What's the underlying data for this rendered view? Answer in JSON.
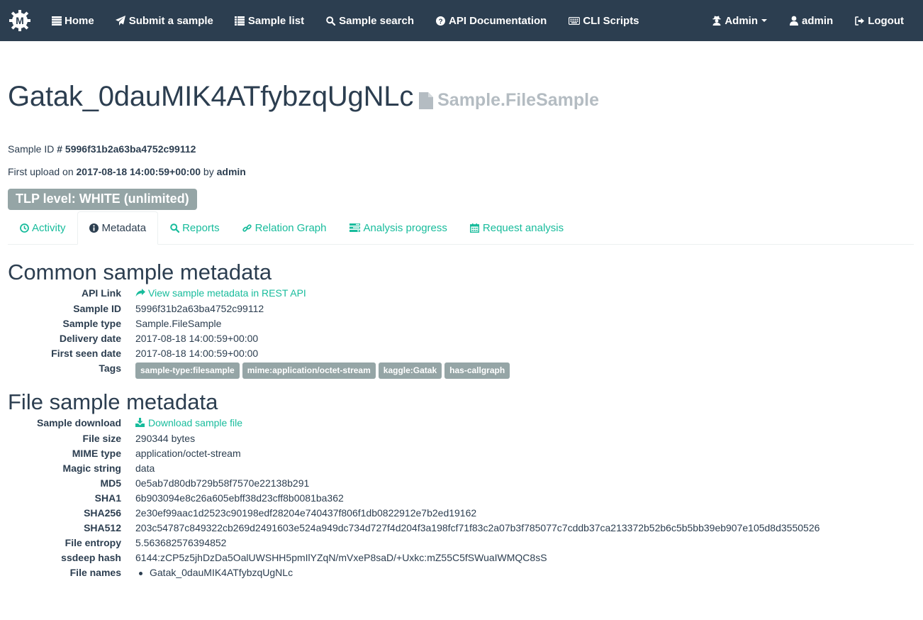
{
  "navbar": {
    "brand_icon": "malice-logo-icon",
    "left": [
      {
        "label": "Home",
        "icon": "list-icon"
      },
      {
        "label": "Submit a sample",
        "icon": "paper-plane-icon"
      },
      {
        "label": "Sample list",
        "icon": "list-icon"
      },
      {
        "label": "Sample search",
        "icon": "search-icon"
      },
      {
        "label": "API Documentation",
        "icon": "question-circle-icon"
      },
      {
        "label": "CLI Scripts",
        "icon": "keyboard-icon"
      }
    ],
    "right": [
      {
        "label": "Admin",
        "icon": "user-secret-icon"
      },
      {
        "label": "admin",
        "icon": "user-icon"
      },
      {
        "label": "Logout",
        "icon": "sign-out-icon"
      }
    ]
  },
  "page": {
    "title": "Gatak_0dauMIK4ATfybzqUgNLc",
    "type": "Sample.FileSample",
    "sample_id_prefix": "Sample ID",
    "sample_id_value": "# 5996f31b2a63ba4752c99112",
    "upload_prefix": "First upload on",
    "upload_date": "2017-08-18 14:00:59+00:00",
    "upload_by_word": "by",
    "upload_user": "admin",
    "tlp": "TLP level: WHITE (unlimited)"
  },
  "tabs": [
    {
      "label": "Activity",
      "icon": "clock-icon",
      "active": false
    },
    {
      "label": "Metadata",
      "icon": "info-circle-icon",
      "active": true
    },
    {
      "label": "Reports",
      "icon": "search-icon",
      "active": false
    },
    {
      "label": "Relation Graph",
      "icon": "link-icon",
      "active": false
    },
    {
      "label": "Analysis progress",
      "icon": "tasks-icon",
      "active": false
    },
    {
      "label": "Request analysis",
      "icon": "calendar-icon",
      "active": false
    }
  ],
  "common": {
    "heading": "Common sample metadata",
    "api_link_label": "API Link",
    "api_link_text": "View sample metadata in REST API",
    "sample_id_label": "Sample ID",
    "sample_id": "5996f31b2a63ba4752c99112",
    "sample_type_label": "Sample type",
    "sample_type": "Sample.FileSample",
    "delivery_label": "Delivery date",
    "delivery": "2017-08-18 14:00:59+00:00",
    "first_seen_label": "First seen date",
    "first_seen": "2017-08-18 14:00:59+00:00",
    "tags_label": "Tags",
    "tags": [
      "sample-type:filesample",
      "mime:application/octet-stream",
      "kaggle:Gatak",
      "has-callgraph"
    ]
  },
  "file": {
    "heading": "File sample metadata",
    "download_label": "Sample download",
    "download_text": "Download sample file",
    "size_label": "File size",
    "size": "290344 bytes",
    "mime_label": "MIME type",
    "mime": "application/octet-stream",
    "magic_label": "Magic string",
    "magic": "data",
    "md5_label": "MD5",
    "md5": "0e5ab7d80db729b58f7570e22138b291",
    "sha1_label": "SHA1",
    "sha1": "6b903094e8c26a605ebff38d23cff8b0081ba362",
    "sha256_label": "SHA256",
    "sha256": "2e30ef99aac1d2523c90198edf28204e740437f806f1db0822912e7b2ed19162",
    "sha512_label": "SHA512",
    "sha512": "203c54787c849322cb269d2491603e524a949dc734d727f4d204f3a198fcf71f83c2a07b3f785077c7cddb37ca213372b52b6c5b5bb39eb907e105d8d3550526",
    "entropy_label": "File entropy",
    "entropy": "5.563682576394852",
    "ssdeep_label": "ssdeep hash",
    "ssdeep": "6144:zCP5z5jhDzDa5OalUWSHH5pmIlYZqN/mVxeP8saD/+Uxkc:mZ55C5fSWuaIWMQC8sS",
    "names_label": "File names",
    "names": [
      "Gatak_0dauMIK4ATfybzqUgNLc"
    ]
  }
}
